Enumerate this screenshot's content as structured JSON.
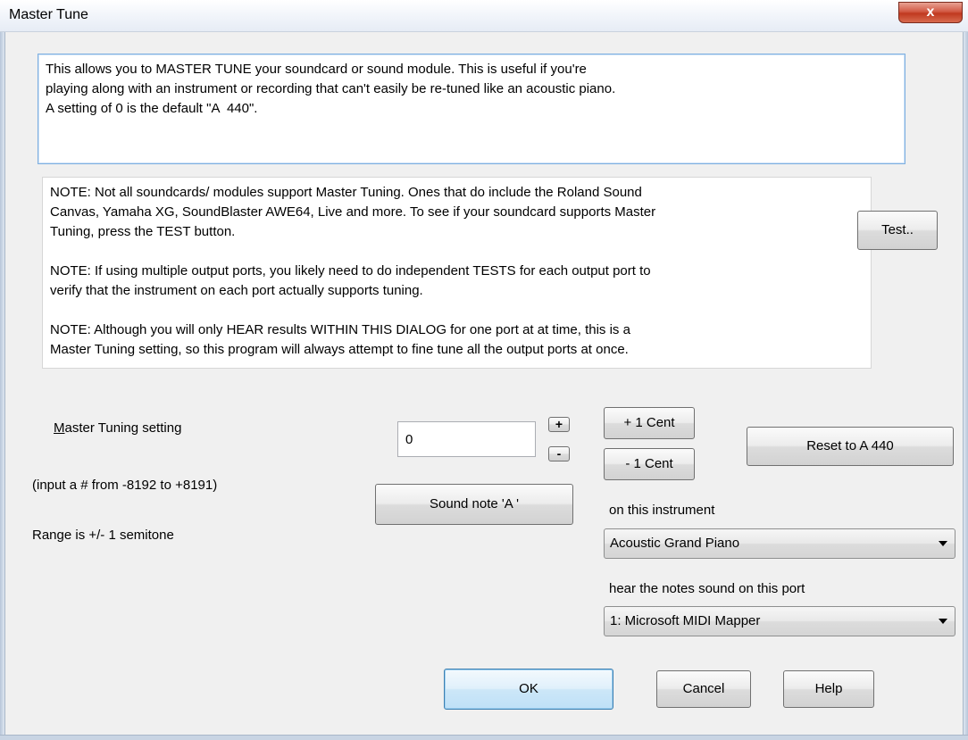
{
  "window": {
    "title": "Master Tune",
    "close_label": "x"
  },
  "info_text": "This allows you to MASTER TUNE your soundcard or sound module. This is useful if you're\nplaying along with an instrument or recording that can't easily be re-tuned like an acoustic piano.\nA setting of 0 is the default \"A  440\".",
  "notes_text": "NOTE: Not all soundcards/ modules support Master Tuning. Ones that do include the Roland Sound\nCanvas, Yamaha XG, SoundBlaster AWE64, Live and more. To see if your soundcard supports Master\nTuning, press the TEST button.\n\nNOTE: If using multiple output ports, you likely need to do independent TESTS for each output port to\nverify that the instrument on each port actually supports tuning.\n\nNOTE: Although you will only HEAR results WITHIN THIS DIALOG for one port at at time, this is a\nMaster Tuning setting, so this program will always attempt to fine tune all the output ports at once.",
  "buttons": {
    "test": "Test..",
    "spin_plus": "+",
    "spin_minus": "-",
    "plus_cent": "+ 1 Cent",
    "minus_cent": "- 1 Cent",
    "reset": "Reset to A 440",
    "sound_note": "Sound note 'A '",
    "ok": "OK",
    "cancel": "Cancel",
    "help": "Help"
  },
  "master_tuning": {
    "label_mnemonic": "M",
    "label_rest": "aster Tuning setting",
    "value": "0",
    "range_input": "(input a # from -8192 to +8191)",
    "range": "Range is +/- 1 semitone"
  },
  "instrument": {
    "label": "on this instrument",
    "selected": "Acoustic Grand Piano"
  },
  "port": {
    "label": "hear the notes sound on this port",
    "selected": "1: Microsoft MIDI Mapper"
  },
  "icons": {
    "dropdown": "chevron-down-icon",
    "close": "close-icon"
  }
}
